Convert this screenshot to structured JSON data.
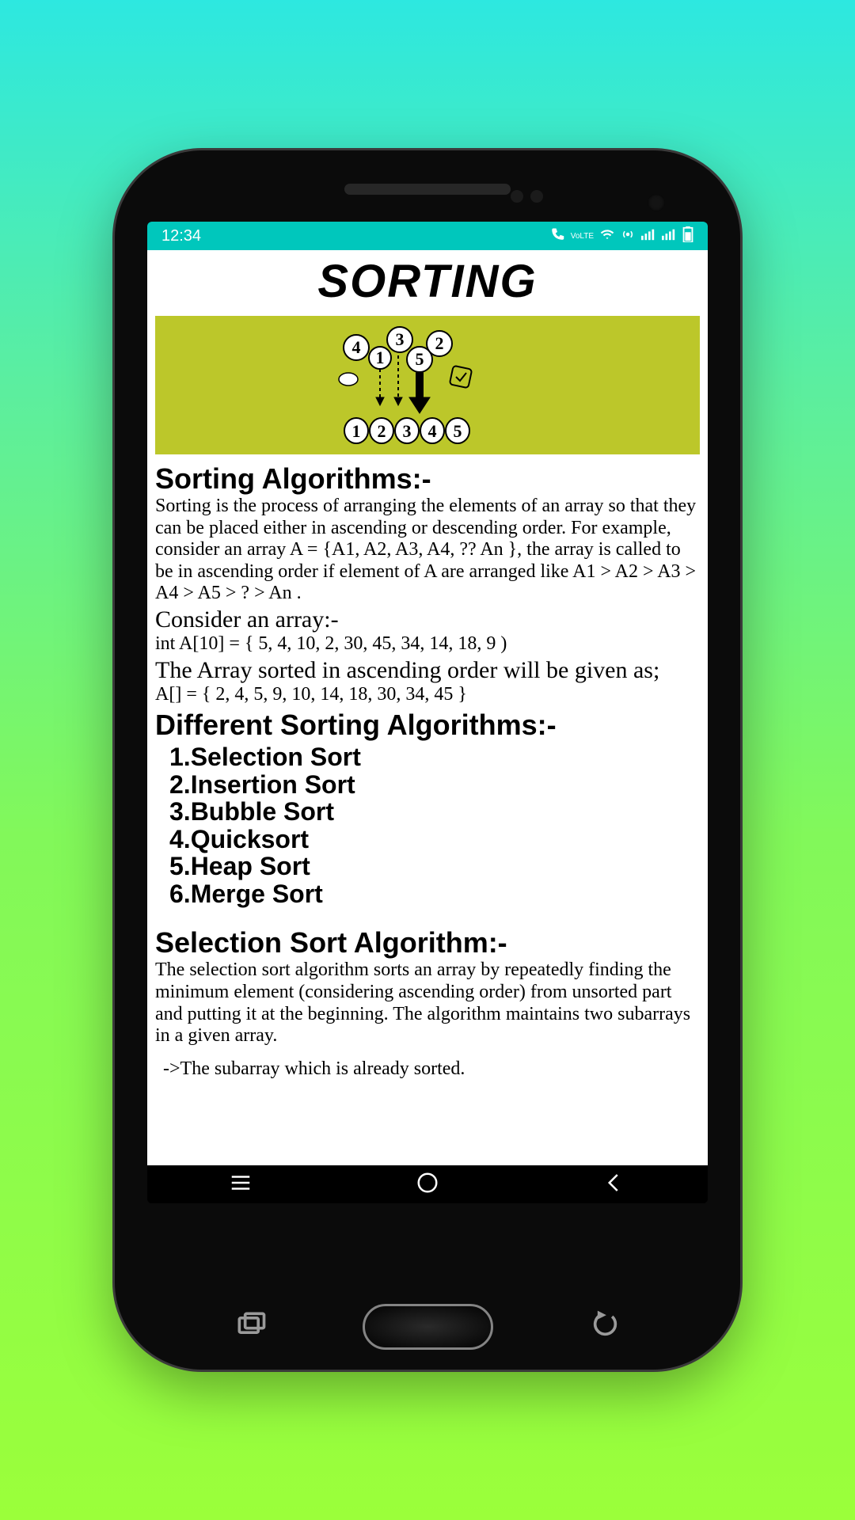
{
  "status": {
    "time": "12:34"
  },
  "app": {
    "title": "SORTING"
  },
  "hero": {
    "top": [
      {
        "n": "4"
      },
      {
        "n": "1"
      },
      {
        "n": "3"
      },
      {
        "n": "5"
      },
      {
        "n": "2"
      }
    ],
    "bottom": [
      {
        "n": "1"
      },
      {
        "n": "2"
      },
      {
        "n": "3"
      },
      {
        "n": "4"
      },
      {
        "n": "5"
      }
    ]
  },
  "sections": {
    "algos_h": "Sorting Algorithms:-",
    "algos_body": "Sorting is the process of arranging the elements of an array so that they can be placed either in ascending or descending order. For example, consider an array A = {A1, A2, A3, A4, ?? An }, the array is called to be in ascending order if element of A are arranged like A1 > A2 > A3 > A4 > A5 > ? > An .",
    "consider_h": "Consider an array:-",
    "consider_body": "int A[10] = { 5, 4, 10, 2, 30, 45, 34, 14, 18, 9 )",
    "asc_h": "The Array sorted in ascending order will be given as;",
    "asc_body": "A[] = { 2, 4, 5, 9, 10, 14, 18, 30, 34, 45 }",
    "diff_h": "Different Sorting Algorithms:-",
    "list": [
      "1.Selection Sort",
      "2.Insertion Sort",
      "3.Bubble Sort",
      "4.Quicksort",
      "5.Heap Sort",
      "6.Merge Sort"
    ],
    "sel_h": "Selection Sort Algorithm:-",
    "sel_body": "The selection sort algorithm sorts an array by repeatedly finding the minimum element (considering ascending order) from unsorted part and putting it at the beginning. The algorithm maintains two subarrays in a given array.",
    "sel_bullet": "->The subarray which is already sorted."
  }
}
